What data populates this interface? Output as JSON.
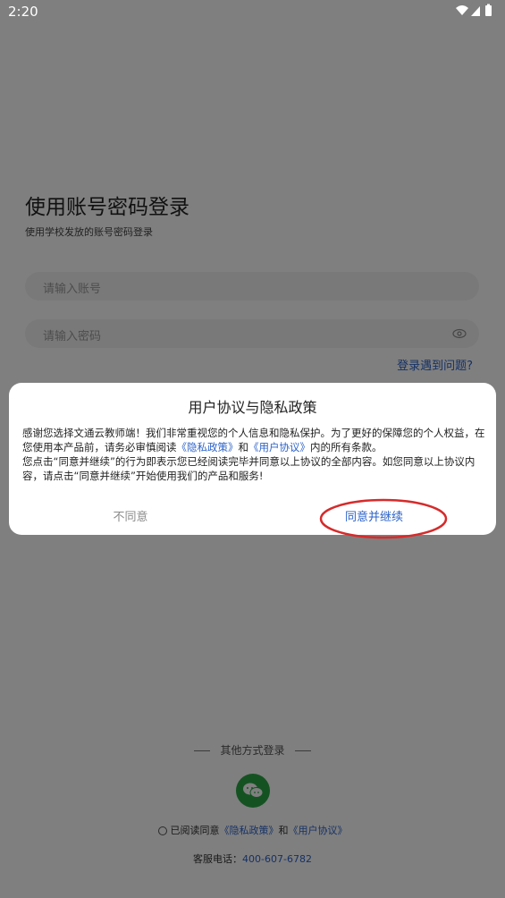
{
  "status_bar": {
    "time": "2:20"
  },
  "login": {
    "title": "使用账号密码登录",
    "subtitle": "使用学校发放的账号密码登录",
    "account_placeholder": "请输入账号",
    "password_placeholder": "请输入密码",
    "forgot_link": "登录遇到问题?"
  },
  "other_login": {
    "label": "其他方式登录"
  },
  "agreement": {
    "prefix": "已阅读同意",
    "privacy_link": "《隐私政策》",
    "and": "和",
    "user_link": "《用户协议》"
  },
  "service": {
    "label": "客服电话：",
    "phone": "400-607-6782"
  },
  "dialog": {
    "title": "用户协议与隐私政策",
    "p1_a": "感谢您选择文通云教师端！我们非常重视您的个人信息和隐私保护。为了更好的保障您的个人权益，在您使用本产品前，请务必审慎阅读",
    "p1_link1": "《隐私政策》",
    "p1_and": "和",
    "p1_link2": "《用户协议》",
    "p1_b": "内的所有条款。",
    "p2": "您点击“同意并继续”的行为即表示您已经阅读完毕并同意以上协议的全部内容。如您同意以上协议内容，请点击“同意并继续”开始使用我们的产品和服务!",
    "disagree": "不同意",
    "agree": "同意并继续"
  },
  "colors": {
    "accent": "#2d63c8",
    "annotation": "#d62b2b",
    "wechat": "#2aa544"
  }
}
